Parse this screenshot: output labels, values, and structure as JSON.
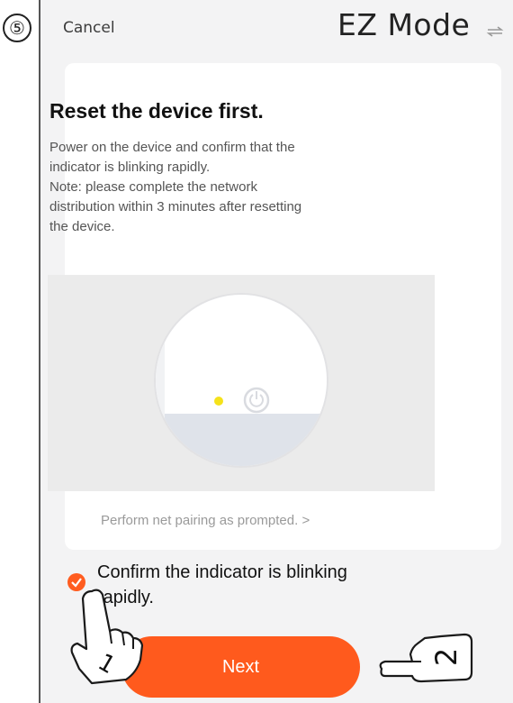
{
  "step_marker": "⑤",
  "header": {
    "cancel_label": "Cancel",
    "title": "EZ Mode"
  },
  "card": {
    "heading": "Reset the device first.",
    "description_lines": [
      "Power on the device and confirm that the",
      "indicator is blinking rapidly.",
      "Note: please complete the network",
      "distribution within 3 minutes after resetting",
      "the device."
    ]
  },
  "pairing_link": "Perform net pairing as prompted. >",
  "confirm_checkbox": {
    "checked": true,
    "line1": "Confirm the indicator is blinking",
    "line2": "rapidly."
  },
  "next_button_label": "Next",
  "annotations": {
    "hand1_number": "1",
    "hand2_number": "2"
  },
  "colors": {
    "accent": "#ff5a1d",
    "indicator": "#f5e21a",
    "card_bg": "#ffffff",
    "screen_bg": "#f3f3f4"
  },
  "icons": {
    "mode_switch": "switch-arrows-icon",
    "power": "power-icon",
    "check": "check-icon",
    "hand": "pointing-hand-icon"
  }
}
